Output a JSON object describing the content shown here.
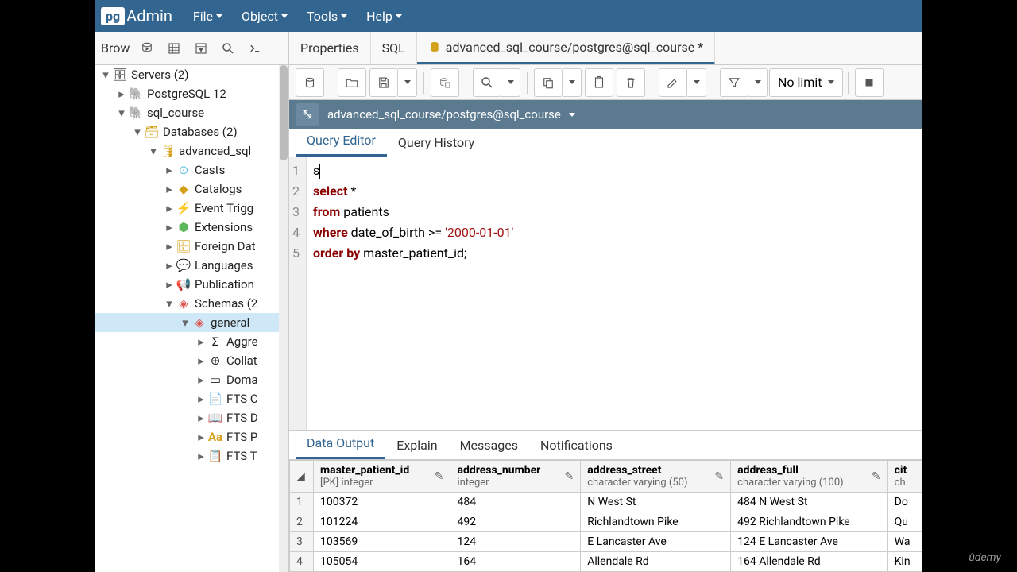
{
  "app_name": "pgAdmin",
  "logo_badge": "pg",
  "logo_text": "Admin",
  "menus": [
    "File",
    "Object",
    "Tools",
    "Help"
  ],
  "browser_label": "Brow",
  "top_tabs": {
    "properties": "Properties",
    "sql": "SQL",
    "query": "advanced_sql_course/postgres@sql_course *"
  },
  "limit_select": "No limit",
  "connection": "advanced_sql_course/postgres@sql_course",
  "editor_tabs": {
    "query_editor": "Query Editor",
    "query_history": "Query History"
  },
  "code": {
    "l1": "s",
    "l2_kw": "select",
    "l2_rest": " *",
    "l3_kw": "from",
    "l3_rest": " patients",
    "l4_kw": "where",
    "l4_rest1": " date_of_birth >= ",
    "l4_str": "'2000-01-01'",
    "l5_kw1": "order",
    "l5_kw2": "by",
    "l5_rest": " master_patient_id;"
  },
  "output_tabs": {
    "data": "Data Output",
    "explain": "Explain",
    "messages": "Messages",
    "notifications": "Notifications"
  },
  "columns": [
    {
      "name": "master_patient_id",
      "type": "[PK] integer"
    },
    {
      "name": "address_number",
      "type": "integer"
    },
    {
      "name": "address_street",
      "type": "character varying (50)"
    },
    {
      "name": "address_full",
      "type": "character varying (100)"
    },
    {
      "name": "cit",
      "type": "ch"
    }
  ],
  "rows": [
    {
      "n": "1",
      "c0": "100372",
      "c1": "484",
      "c2": "N West St",
      "c3": "484 N West St",
      "c4": "Do"
    },
    {
      "n": "2",
      "c0": "101224",
      "c1": "492",
      "c2": "Richlandtown Pike",
      "c3": "492 Richlandtown Pike",
      "c4": "Qu"
    },
    {
      "n": "3",
      "c0": "103569",
      "c1": "124",
      "c2": "E Lancaster Ave",
      "c3": "124 E Lancaster Ave",
      "c4": "Wa"
    },
    {
      "n": "4",
      "c0": "105054",
      "c1": "164",
      "c2": "Allendale Rd",
      "c3": "164 Allendale Rd",
      "c4": "Kin"
    }
  ],
  "tree": {
    "servers": "Servers (2)",
    "pg12": "PostgreSQL 12",
    "sql_course": "sql_course",
    "databases": "Databases (2)",
    "adv": "advanced_sql",
    "casts": "Casts",
    "catalogs": "Catalogs",
    "event_trigg": "Event Trigg",
    "extensions": "Extensions",
    "foreign_data": "Foreign Dat",
    "languages": "Languages",
    "publication": "Publication",
    "schemas": "Schemas (2",
    "general": "general",
    "aggre": "Aggre",
    "collat": "Collat",
    "doma": "Doma",
    "fts_c": "FTS C",
    "fts_d": "FTS D",
    "fts_f": "FTS P",
    "fts_t": "FTS T"
  },
  "watermark": "ûdemy"
}
